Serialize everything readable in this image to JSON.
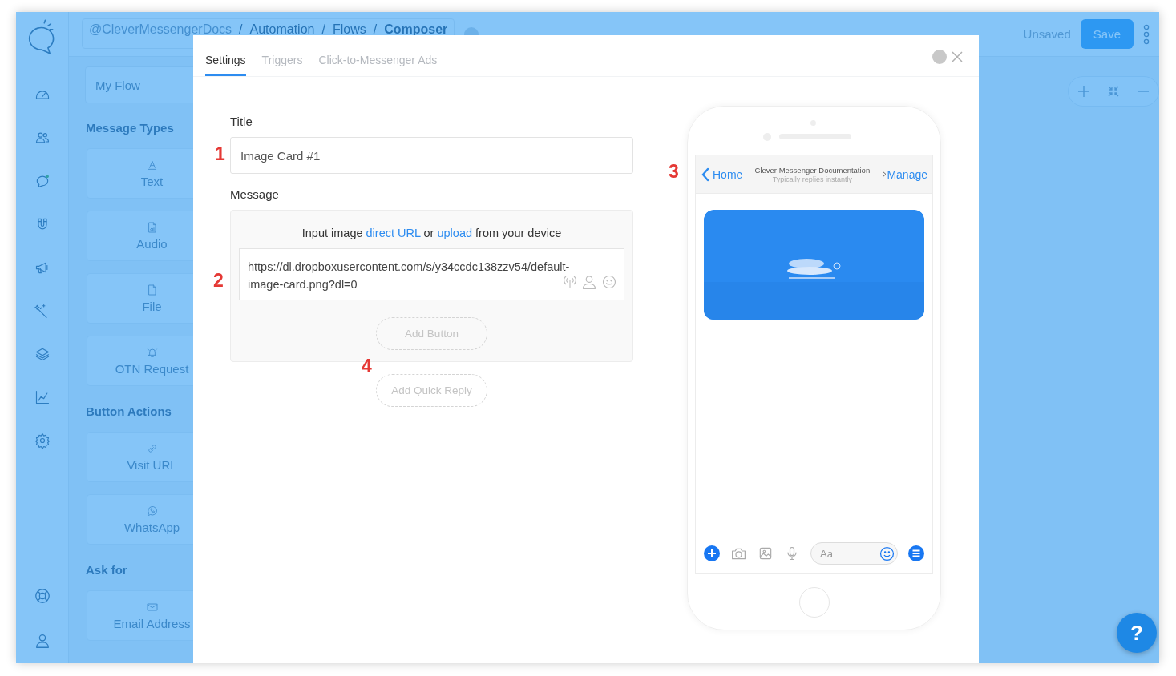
{
  "topbar": {
    "breadcrumb": [
      {
        "label": "@CleverMessengerDocs"
      },
      {
        "label": "Automation"
      },
      {
        "label": "Flows"
      },
      {
        "label": "Composer"
      }
    ],
    "separator": "/",
    "status": "Unsaved",
    "save": "Save"
  },
  "panel": {
    "flow_name": "My Flow",
    "sections": [
      {
        "title": "Message Types",
        "items": [
          {
            "label": "Text"
          },
          {
            "label": "Audio"
          },
          {
            "label": "File"
          },
          {
            "label": "OTN Request"
          }
        ]
      },
      {
        "title": "Button Actions",
        "items": [
          {
            "label": "Visit URL"
          },
          {
            "label": "WhatsApp"
          }
        ]
      },
      {
        "title": "Ask for",
        "items": [
          {
            "label": "Email Address"
          }
        ]
      }
    ]
  },
  "modal": {
    "tabs": [
      {
        "label": "Settings",
        "selected": true
      },
      {
        "label": "Triggers",
        "selected": false
      },
      {
        "label": "Click-to-Messenger Ads",
        "selected": false
      }
    ],
    "title_label": "Title",
    "title_value": "Image Card #1",
    "message_label": "Message",
    "hint": {
      "before": "Input image",
      "link1": "direct URL",
      "middle": "or",
      "link2": "upload",
      "after": "from your device"
    },
    "url_value": "https://dl.dropboxusercontent.com/s/y34ccdc138zzv54/default-image-card.png?dl=0",
    "buttons": [
      "Add Button",
      "Add Quick Reply"
    ],
    "annotations": [
      "1",
      "2",
      "3",
      "4"
    ],
    "phone": {
      "back": "Home",
      "page_name": "Clever Messenger Documentation",
      "page_status": "Typically replies instantly",
      "manage": "Manage",
      "composer_placeholder": "Aa"
    }
  },
  "help": "?"
}
